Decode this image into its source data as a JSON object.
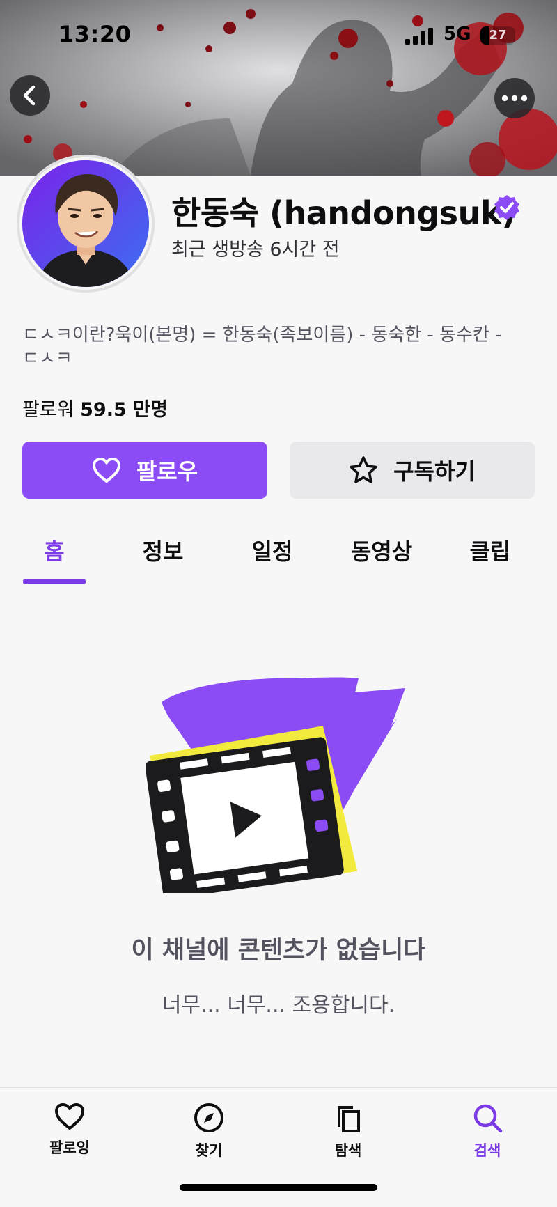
{
  "status_bar": {
    "time": "13:20",
    "network": "5G",
    "battery": "27"
  },
  "channel": {
    "name": "한동숙 (handongsuk)",
    "last_live": "최근 생방송 6시간 전",
    "bio": "ㄷㅅㅋ이란?욱이(본명) = 한동숙(족보이름) - 동숙한 - 동수칸 - ㄷㅅㅋ",
    "followers_label": "팔로워",
    "followers_count": "59.5 만명"
  },
  "actions": {
    "follow_label": "팔로우",
    "subscribe_label": "구독하기"
  },
  "tabs": [
    {
      "label": "홈",
      "active": true
    },
    {
      "label": "정보",
      "active": false
    },
    {
      "label": "일정",
      "active": false
    },
    {
      "label": "동영상",
      "active": false
    },
    {
      "label": "클립",
      "active": false
    }
  ],
  "empty_state": {
    "title": "이 채널에 콘텐츠가 없습니다",
    "subtitle": "너무... 너무... 조용합니다."
  },
  "bottom_nav": [
    {
      "label": "팔로잉",
      "icon": "heart-icon",
      "active": false
    },
    {
      "label": "찾기",
      "icon": "compass-icon",
      "active": false
    },
    {
      "label": "탐색",
      "icon": "browse-icon",
      "active": false
    },
    {
      "label": "검색",
      "icon": "search-icon",
      "active": true
    }
  ],
  "colors": {
    "accent": "#8b4cf6",
    "accent_text": "#7c3be6",
    "background": "#f7f7f8",
    "secondary_button": "#e9e9ec",
    "muted_text": "#53535f"
  }
}
